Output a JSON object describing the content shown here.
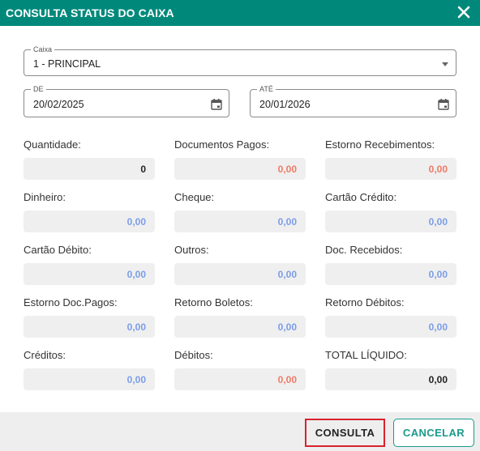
{
  "dialog": {
    "title": "CONSULTA STATUS DO CAIXA"
  },
  "caixa": {
    "label": "Caixa",
    "value": "1 - PRINCIPAL"
  },
  "de": {
    "label": "DE",
    "value": "20/02/2025"
  },
  "ate": {
    "label": "ATÉ",
    "value": "20/01/2026"
  },
  "stats": [
    {
      "label": "Quantidade:",
      "value": "0",
      "color": "#222222"
    },
    {
      "label": "Documentos Pagos:",
      "value": "0,00",
      "color": "#ef7a66"
    },
    {
      "label": "Estorno Recebimentos:",
      "value": "0,00",
      "color": "#ef7a66"
    },
    {
      "label": "Dinheiro:",
      "value": "0,00",
      "color": "#7b9de8"
    },
    {
      "label": "Cheque:",
      "value": "0,00",
      "color": "#7b9de8"
    },
    {
      "label": "Cartão Crédito:",
      "value": "0,00",
      "color": "#7b9de8"
    },
    {
      "label": "Cartão Débito:",
      "value": "0,00",
      "color": "#7b9de8"
    },
    {
      "label": "Outros:",
      "value": "0,00",
      "color": "#7b9de8"
    },
    {
      "label": "Doc. Recebidos:",
      "value": "0,00",
      "color": "#7b9de8"
    },
    {
      "label": "Estorno Doc.Pagos:",
      "value": "0,00",
      "color": "#7b9de8"
    },
    {
      "label": "Retorno Boletos:",
      "value": "0,00",
      "color": "#7b9de8"
    },
    {
      "label": "Retorno Débitos:",
      "value": "0,00",
      "color": "#7b9de8"
    },
    {
      "label": "Créditos:",
      "value": "0,00",
      "color": "#7b9de8"
    },
    {
      "label": "Débitos:",
      "value": "0,00",
      "color": "#ef7a66"
    },
    {
      "label": "TOTAL LÍQUIDO:",
      "value": "0,00",
      "color": "#222222"
    }
  ],
  "buttons": {
    "consulta": "CONSULTA",
    "cancelar": "CANCELAR"
  },
  "icons": {
    "close": "close-icon",
    "dropdown": "chevron-down-icon",
    "calendar": "calendar-icon"
  },
  "colors": {
    "header": "#00897b",
    "accent": "#1a9a8c",
    "highlight": "#d9232d"
  }
}
